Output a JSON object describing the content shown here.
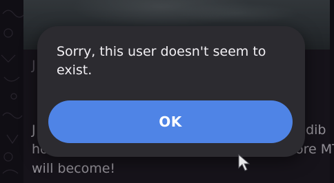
{
  "background": {
    "first_char": "J",
    "line1_start": "J",
    "line1_end": "redib",
    "line2_start": "ho",
    "line2_end": "ore MT",
    "line3": "will become!"
  },
  "dialog": {
    "message": "Sorry, this user doesn't seem to exist.",
    "ok_label": "OK"
  },
  "colors": {
    "accent": "#4f84e6",
    "dialog_bg": "#2c2b30"
  }
}
